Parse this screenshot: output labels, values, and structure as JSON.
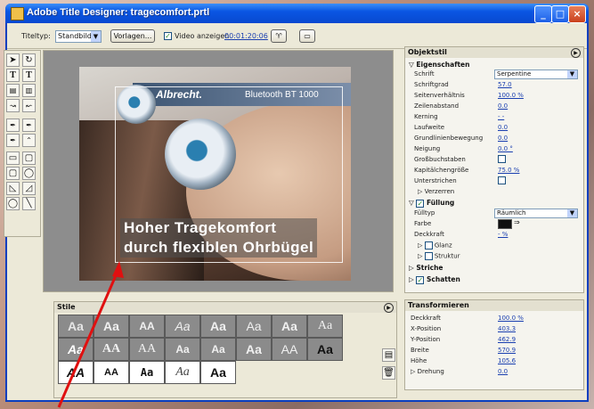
{
  "window": {
    "title": "Adobe Title Designer: tragecomfort.prtl",
    "minimize": "_",
    "maximize": "□",
    "close": "×"
  },
  "toolbar": {
    "titeltyp_label": "Titeltyp:",
    "titeltyp_value": "Standbild",
    "vorlagen_label": "Vorlagen...",
    "video_label": "Video anzeigen",
    "timecode": "00:01:20:06"
  },
  "preview": {
    "brand_left": "Albrecht.",
    "brand_right": "Bluetooth  BT 1000",
    "caption_line1": "Hoher Tragekomfort",
    "caption_line2": "durch flexiblen Ohrbügel"
  },
  "objektstil": {
    "title": "Objektstil",
    "eigenschaften": "Eigenschaften",
    "props": [
      {
        "label": "Schrift",
        "value": "Serpentine"
      },
      {
        "label": "Schriftgrad",
        "value": "57.0"
      },
      {
        "label": "Seitenverhältnis",
        "value": "100.0 %"
      },
      {
        "label": "Zeilenabstand",
        "value": "0.0"
      },
      {
        "label": "Kerning",
        "value": "- -"
      },
      {
        "label": "Laufweite",
        "value": "0.0"
      },
      {
        "label": "Grundlinienbewegung",
        "value": "0.0"
      },
      {
        "label": "Neigung",
        "value": "0.0 °"
      },
      {
        "label": "Großbuchstaben",
        "value": ""
      },
      {
        "label": "Kapitälchengröße",
        "value": "75.0 %"
      },
      {
        "label": "Unterstrichen",
        "value": ""
      }
    ],
    "verzerren": "Verzerren",
    "fuellung": "Füllung",
    "fill_props": [
      {
        "label": "Fülltyp",
        "value": "Räumlich"
      },
      {
        "label": "Farbe",
        "value": ""
      },
      {
        "label": "Deckkraft",
        "value": "- %"
      }
    ],
    "glanz": "Glanz",
    "struktur": "Struktur",
    "striche": "Striche",
    "schatten": "Schatten"
  },
  "stile": {
    "title": "Stile",
    "swatches": [
      "Aa",
      "Aa",
      "AA",
      "Aa",
      "Aa",
      "Aa",
      "Aa",
      "Aa",
      "Aa",
      "AA",
      "AA",
      "Aa",
      "Aa",
      "Aa",
      "AA",
      "Aa",
      "AA",
      "AA",
      "Aa",
      "Aa",
      "Aa"
    ]
  },
  "transformieren": {
    "title": "Transformieren",
    "rows": [
      {
        "label": "Deckkraft",
        "value": "100.0 %"
      },
      {
        "label": "X-Position",
        "value": "403.3"
      },
      {
        "label": "Y-Position",
        "value": "462.9"
      },
      {
        "label": "Breite",
        "value": "570.9"
      },
      {
        "label": "Höhe",
        "value": "105.6"
      },
      {
        "label": "Drehung",
        "value": "0.0"
      }
    ]
  },
  "colors": {
    "accent": "#0a56e3",
    "arrow": "#e01010"
  }
}
